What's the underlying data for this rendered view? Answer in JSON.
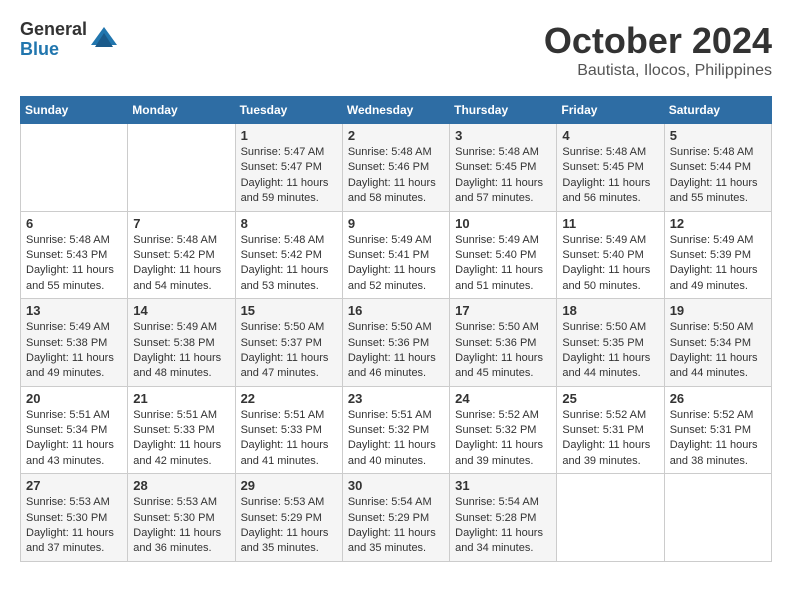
{
  "logo": {
    "general": "General",
    "blue": "Blue"
  },
  "title": "October 2024",
  "subtitle": "Bautista, Ilocos, Philippines",
  "days_header": [
    "Sunday",
    "Monday",
    "Tuesday",
    "Wednesday",
    "Thursday",
    "Friday",
    "Saturday"
  ],
  "weeks": [
    [
      {
        "day": "",
        "sunrise": "",
        "sunset": "",
        "daylight": ""
      },
      {
        "day": "",
        "sunrise": "",
        "sunset": "",
        "daylight": ""
      },
      {
        "day": "1",
        "sunrise": "Sunrise: 5:47 AM",
        "sunset": "Sunset: 5:47 PM",
        "daylight": "Daylight: 11 hours and 59 minutes."
      },
      {
        "day": "2",
        "sunrise": "Sunrise: 5:48 AM",
        "sunset": "Sunset: 5:46 PM",
        "daylight": "Daylight: 11 hours and 58 minutes."
      },
      {
        "day": "3",
        "sunrise": "Sunrise: 5:48 AM",
        "sunset": "Sunset: 5:45 PM",
        "daylight": "Daylight: 11 hours and 57 minutes."
      },
      {
        "day": "4",
        "sunrise": "Sunrise: 5:48 AM",
        "sunset": "Sunset: 5:45 PM",
        "daylight": "Daylight: 11 hours and 56 minutes."
      },
      {
        "day": "5",
        "sunrise": "Sunrise: 5:48 AM",
        "sunset": "Sunset: 5:44 PM",
        "daylight": "Daylight: 11 hours and 55 minutes."
      }
    ],
    [
      {
        "day": "6",
        "sunrise": "Sunrise: 5:48 AM",
        "sunset": "Sunset: 5:43 PM",
        "daylight": "Daylight: 11 hours and 55 minutes."
      },
      {
        "day": "7",
        "sunrise": "Sunrise: 5:48 AM",
        "sunset": "Sunset: 5:42 PM",
        "daylight": "Daylight: 11 hours and 54 minutes."
      },
      {
        "day": "8",
        "sunrise": "Sunrise: 5:48 AM",
        "sunset": "Sunset: 5:42 PM",
        "daylight": "Daylight: 11 hours and 53 minutes."
      },
      {
        "day": "9",
        "sunrise": "Sunrise: 5:49 AM",
        "sunset": "Sunset: 5:41 PM",
        "daylight": "Daylight: 11 hours and 52 minutes."
      },
      {
        "day": "10",
        "sunrise": "Sunrise: 5:49 AM",
        "sunset": "Sunset: 5:40 PM",
        "daylight": "Daylight: 11 hours and 51 minutes."
      },
      {
        "day": "11",
        "sunrise": "Sunrise: 5:49 AM",
        "sunset": "Sunset: 5:40 PM",
        "daylight": "Daylight: 11 hours and 50 minutes."
      },
      {
        "day": "12",
        "sunrise": "Sunrise: 5:49 AM",
        "sunset": "Sunset: 5:39 PM",
        "daylight": "Daylight: 11 hours and 49 minutes."
      }
    ],
    [
      {
        "day": "13",
        "sunrise": "Sunrise: 5:49 AM",
        "sunset": "Sunset: 5:38 PM",
        "daylight": "Daylight: 11 hours and 49 minutes."
      },
      {
        "day": "14",
        "sunrise": "Sunrise: 5:49 AM",
        "sunset": "Sunset: 5:38 PM",
        "daylight": "Daylight: 11 hours and 48 minutes."
      },
      {
        "day": "15",
        "sunrise": "Sunrise: 5:50 AM",
        "sunset": "Sunset: 5:37 PM",
        "daylight": "Daylight: 11 hours and 47 minutes."
      },
      {
        "day": "16",
        "sunrise": "Sunrise: 5:50 AM",
        "sunset": "Sunset: 5:36 PM",
        "daylight": "Daylight: 11 hours and 46 minutes."
      },
      {
        "day": "17",
        "sunrise": "Sunrise: 5:50 AM",
        "sunset": "Sunset: 5:36 PM",
        "daylight": "Daylight: 11 hours and 45 minutes."
      },
      {
        "day": "18",
        "sunrise": "Sunrise: 5:50 AM",
        "sunset": "Sunset: 5:35 PM",
        "daylight": "Daylight: 11 hours and 44 minutes."
      },
      {
        "day": "19",
        "sunrise": "Sunrise: 5:50 AM",
        "sunset": "Sunset: 5:34 PM",
        "daylight": "Daylight: 11 hours and 44 minutes."
      }
    ],
    [
      {
        "day": "20",
        "sunrise": "Sunrise: 5:51 AM",
        "sunset": "Sunset: 5:34 PM",
        "daylight": "Daylight: 11 hours and 43 minutes."
      },
      {
        "day": "21",
        "sunrise": "Sunrise: 5:51 AM",
        "sunset": "Sunset: 5:33 PM",
        "daylight": "Daylight: 11 hours and 42 minutes."
      },
      {
        "day": "22",
        "sunrise": "Sunrise: 5:51 AM",
        "sunset": "Sunset: 5:33 PM",
        "daylight": "Daylight: 11 hours and 41 minutes."
      },
      {
        "day": "23",
        "sunrise": "Sunrise: 5:51 AM",
        "sunset": "Sunset: 5:32 PM",
        "daylight": "Daylight: 11 hours and 40 minutes."
      },
      {
        "day": "24",
        "sunrise": "Sunrise: 5:52 AM",
        "sunset": "Sunset: 5:32 PM",
        "daylight": "Daylight: 11 hours and 39 minutes."
      },
      {
        "day": "25",
        "sunrise": "Sunrise: 5:52 AM",
        "sunset": "Sunset: 5:31 PM",
        "daylight": "Daylight: 11 hours and 39 minutes."
      },
      {
        "day": "26",
        "sunrise": "Sunrise: 5:52 AM",
        "sunset": "Sunset: 5:31 PM",
        "daylight": "Daylight: 11 hours and 38 minutes."
      }
    ],
    [
      {
        "day": "27",
        "sunrise": "Sunrise: 5:53 AM",
        "sunset": "Sunset: 5:30 PM",
        "daylight": "Daylight: 11 hours and 37 minutes."
      },
      {
        "day": "28",
        "sunrise": "Sunrise: 5:53 AM",
        "sunset": "Sunset: 5:30 PM",
        "daylight": "Daylight: 11 hours and 36 minutes."
      },
      {
        "day": "29",
        "sunrise": "Sunrise: 5:53 AM",
        "sunset": "Sunset: 5:29 PM",
        "daylight": "Daylight: 11 hours and 35 minutes."
      },
      {
        "day": "30",
        "sunrise": "Sunrise: 5:54 AM",
        "sunset": "Sunset: 5:29 PM",
        "daylight": "Daylight: 11 hours and 35 minutes."
      },
      {
        "day": "31",
        "sunrise": "Sunrise: 5:54 AM",
        "sunset": "Sunset: 5:28 PM",
        "daylight": "Daylight: 11 hours and 34 minutes."
      },
      {
        "day": "",
        "sunrise": "",
        "sunset": "",
        "daylight": ""
      },
      {
        "day": "",
        "sunrise": "",
        "sunset": "",
        "daylight": ""
      }
    ]
  ]
}
